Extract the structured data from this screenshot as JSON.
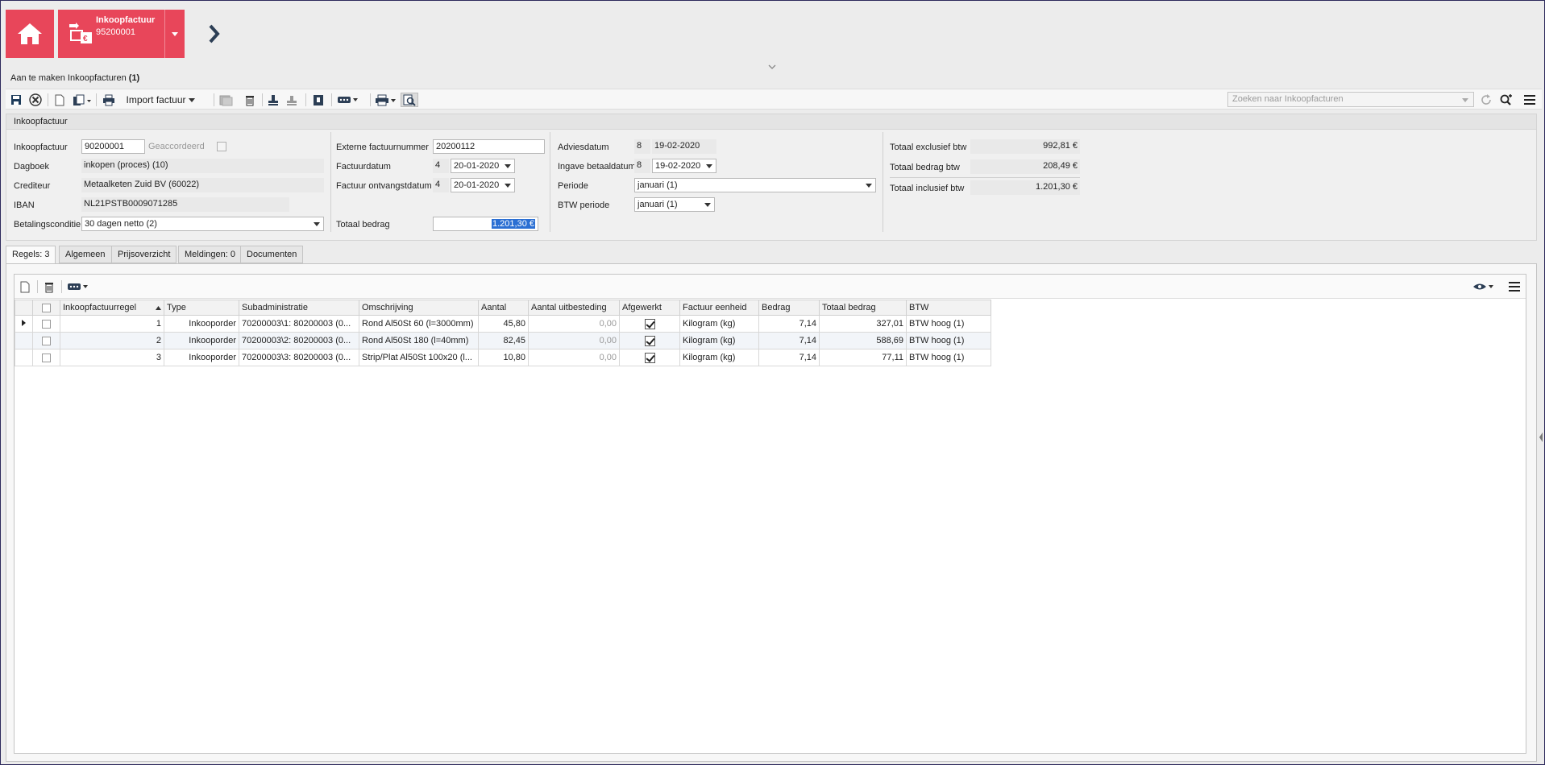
{
  "nav": {
    "doc_title": "Inkoopfactuur",
    "doc_number": "95200001"
  },
  "breadcrumb": {
    "text": "Aan te maken Inkoopfacturen",
    "count": "(1)"
  },
  "toolbar": {
    "import_label": "Import factuur",
    "search_placeholder": "Zoeken naar Inkoopfacturen"
  },
  "header": {
    "panel_title": "Inkoopfactuur",
    "col1": {
      "inkoopfactuur_label": "Inkoopfactuur",
      "inkoopfactuur_value": "90200001",
      "geaccordeerd_label": "Geaccordeerd",
      "dagboek_label": "Dagboek",
      "dagboek_value": "inkopen (proces) (10)",
      "crediteur_label": "Crediteur",
      "crediteur_value": "Metaalketen Zuid BV (60022)",
      "iban_label": "IBAN",
      "iban_value": "NL21PSTB0009071285",
      "betalingsconditie_label": "Betalingsconditie",
      "betalingsconditie_value": "30 dagen netto (2)"
    },
    "col2": {
      "extern_label": "Externe factuurnummer",
      "extern_value": "20200112",
      "factuurdatum_label": "Factuurdatum",
      "factuurdatum_week": "4",
      "factuurdatum_value": "20-01-2020",
      "ontvangst_label": "Factuur ontvangstdatum",
      "ontvangst_week": "4",
      "ontvangst_value": "20-01-2020",
      "totaal_label": "Totaal bedrag",
      "totaal_value": "1.201,30 €"
    },
    "col3": {
      "advies_label": "Adviesdatum",
      "advies_week": "8",
      "advies_value": "19-02-2020",
      "betaal_label": "Ingave betaaldatum",
      "betaal_week": "8",
      "betaal_value": "19-02-2020",
      "periode_label": "Periode",
      "periode_value": "januari (1)",
      "btwperiode_label": "BTW periode",
      "btwperiode_value": "januari (1)"
    },
    "col4": {
      "excl_label": "Totaal exclusief btw",
      "excl_value": "992,81 €",
      "btw_label": "Totaal bedrag btw",
      "btw_value": "208,49 €",
      "incl_label": "Totaal inclusief btw",
      "incl_value": "1.201,30 €"
    }
  },
  "tabs": [
    "Regels: 3",
    "Algemeen",
    "Prijsoverzicht",
    "Meldingen: 0",
    "Documenten"
  ],
  "grid": {
    "columns": [
      "Inkoopfactuurregel",
      "Type",
      "Subadministratie",
      "Omschrijving",
      "Aantal",
      "Aantal uitbesteding",
      "Afgewerkt",
      "Factuur eenheid",
      "Bedrag",
      "Totaal bedrag",
      "BTW"
    ],
    "rows": [
      {
        "regel": "1",
        "type": "Inkooporder",
        "sub": "70200003\\1: 80200003 (0...",
        "omschrijving": "Rond Al50St 60 (l=3000mm)",
        "aantal": "45,80",
        "uitbesteding": "0,00",
        "afgewerkt": true,
        "eenheid": "Kilogram (kg)",
        "bedrag": "7,14",
        "totaal": "327,01",
        "btw": "BTW hoog (1)"
      },
      {
        "regel": "2",
        "type": "Inkooporder",
        "sub": "70200003\\2: 80200003 (0...",
        "omschrijving": "Rond Al50St 180 (l=40mm)",
        "aantal": "82,45",
        "uitbesteding": "0,00",
        "afgewerkt": true,
        "eenheid": "Kilogram (kg)",
        "bedrag": "7,14",
        "totaal": "588,69",
        "btw": "BTW hoog (1)"
      },
      {
        "regel": "3",
        "type": "Inkooporder",
        "sub": "70200003\\3: 80200003 (0...",
        "omschrijving": "Strip/Plat Al50St 100x20 (l...",
        "aantal": "10,80",
        "uitbesteding": "0,00",
        "afgewerkt": true,
        "eenheid": "Kilogram (kg)",
        "bedrag": "7,14",
        "totaal": "77,11",
        "btw": "BTW hoog (1)"
      }
    ]
  },
  "colors": {
    "accent": "#e8465a",
    "selection": "#2b6fd3"
  }
}
